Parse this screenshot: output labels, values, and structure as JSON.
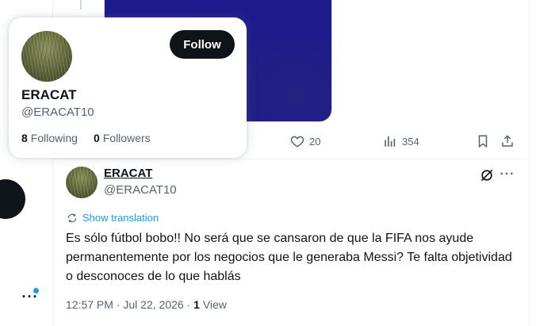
{
  "hover_card": {
    "name": "ERACAT",
    "handle": "@ERACAT10",
    "follow_label": "Follow",
    "following_count": "8",
    "following_label": "Following",
    "followers_count": "0",
    "followers_label": "Followers"
  },
  "post_actions": {
    "likes": "20",
    "views": "354"
  },
  "reply": {
    "name": "ERACAT",
    "handle": "@ERACAT10",
    "show_translation": "Show translation",
    "text": "Es sólo fútbol bobo!! No será que se cansaron de que la FIFA nos ayude permanentemente por los negocios que le generaba Messi? Te falta objetividad o desconoces de lo que hablás",
    "time": "12:57 PM",
    "date": "Jul 22, 2026",
    "views_count": "1",
    "views_label": "View"
  },
  "colors": {
    "accent": "#1d9bf0",
    "text_primary": "#0f1419",
    "text_secondary": "#536471",
    "media_bg": "#1d1b8c"
  },
  "icons": [
    "heart-icon",
    "views-icon",
    "bookmark-icon",
    "share-icon",
    "grok-icon",
    "more-icon",
    "translate-icon"
  ]
}
